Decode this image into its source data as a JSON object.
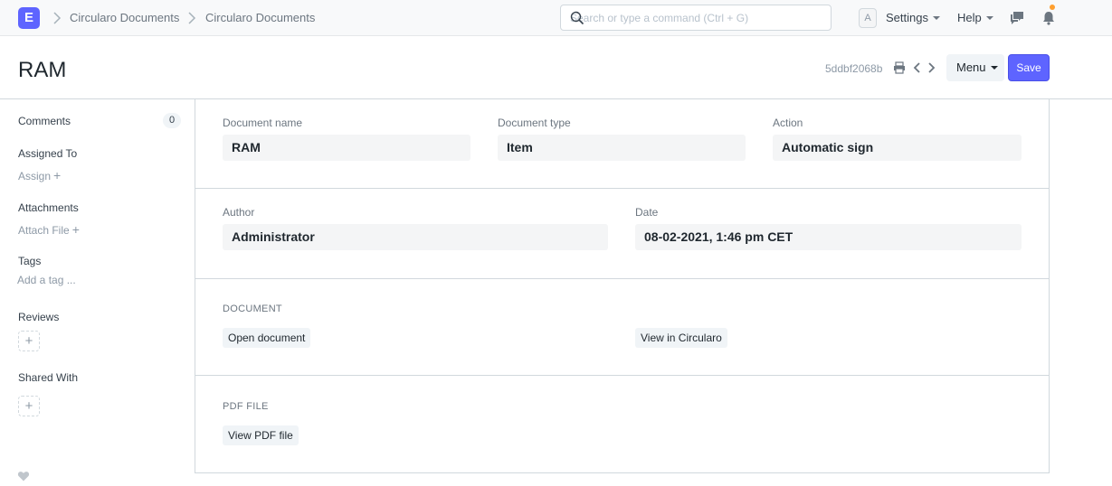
{
  "navbar": {
    "logo_letter": "E",
    "breadcrumbs": [
      "Circularo Documents",
      "Circularo Documents"
    ],
    "search_placeholder": "Search or type a command (Ctrl + G)",
    "avatar_letter": "A",
    "settings_label": "Settings",
    "help_label": "Help",
    "accent_color": "#5e64ff",
    "notification_dot_color": "#ff9f2e"
  },
  "page": {
    "title": "RAM",
    "doc_id": "5ddbf2068b",
    "menu_label": "Menu",
    "save_label": "Save"
  },
  "sidebar": {
    "comments_label": "Comments",
    "comments_count": "0",
    "assigned_label": "Assigned To",
    "assign_link": "Assign",
    "attachments_label": "Attachments",
    "attach_link": "Attach File",
    "tags_label": "Tags",
    "add_tag_link": "Add a tag ...",
    "reviews_label": "Reviews",
    "shared_label": "Shared With",
    "add_symbol": "+"
  },
  "form": {
    "row1": [
      {
        "label": "Document name",
        "value": "RAM"
      },
      {
        "label": "Document type",
        "value": "Item"
      },
      {
        "label": "Action",
        "value": "Automatic sign"
      }
    ],
    "row2": [
      {
        "label": "Author",
        "value": "Administrator"
      },
      {
        "label": "Date",
        "value": "08-02-2021, 1:46 pm CET"
      }
    ],
    "document_section": {
      "heading": "DOCUMENT",
      "open_button": "Open document",
      "view_button": "View in Circularo"
    },
    "pdf_section": {
      "heading": "PDF FILE",
      "view_pdf_button": "View PDF file"
    }
  },
  "icons": {
    "search": "search-icon",
    "chat": "chat-icon",
    "bell": "bell-icon",
    "print": "print-icon",
    "prev": "chevron-left-icon",
    "next": "chevron-right-icon",
    "like": "heart-icon"
  }
}
